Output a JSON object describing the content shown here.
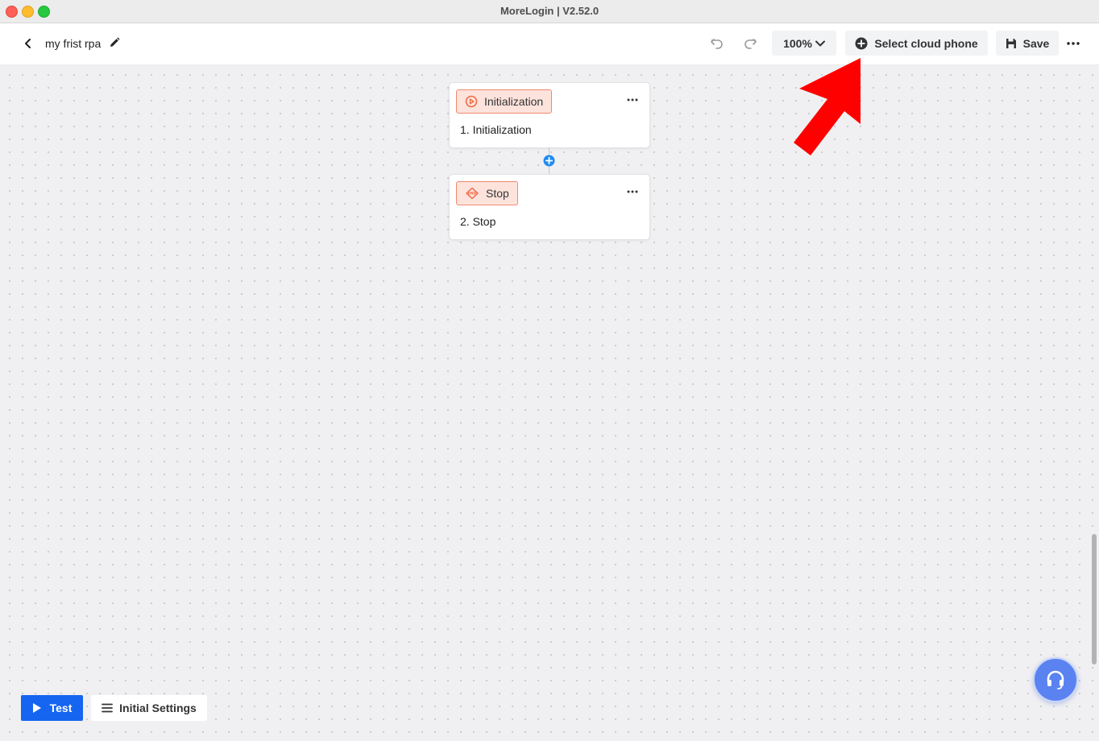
{
  "window": {
    "title": "MoreLogin | V2.52.0"
  },
  "toolbar": {
    "flow_name": "my frist rpa",
    "zoom_label": "100%",
    "cloud_phone_label": "Select cloud phone",
    "save_label": "Save"
  },
  "nodes": [
    {
      "tag": "Initialization",
      "description": "1. Initialization",
      "icon": "play-circle-icon"
    },
    {
      "tag": "Stop",
      "description": "2. Stop",
      "icon": "stop-diamond-icon"
    }
  ],
  "bottom": {
    "test_label": "Test",
    "settings_label": "Initial Settings"
  },
  "colors": {
    "accent_blue": "#1565f0",
    "node_tag_bg": "#fde3dc",
    "node_tag_border": "#f08a6c",
    "annotation_arrow": "#ff0000",
    "support_button": "#5a82f0"
  }
}
